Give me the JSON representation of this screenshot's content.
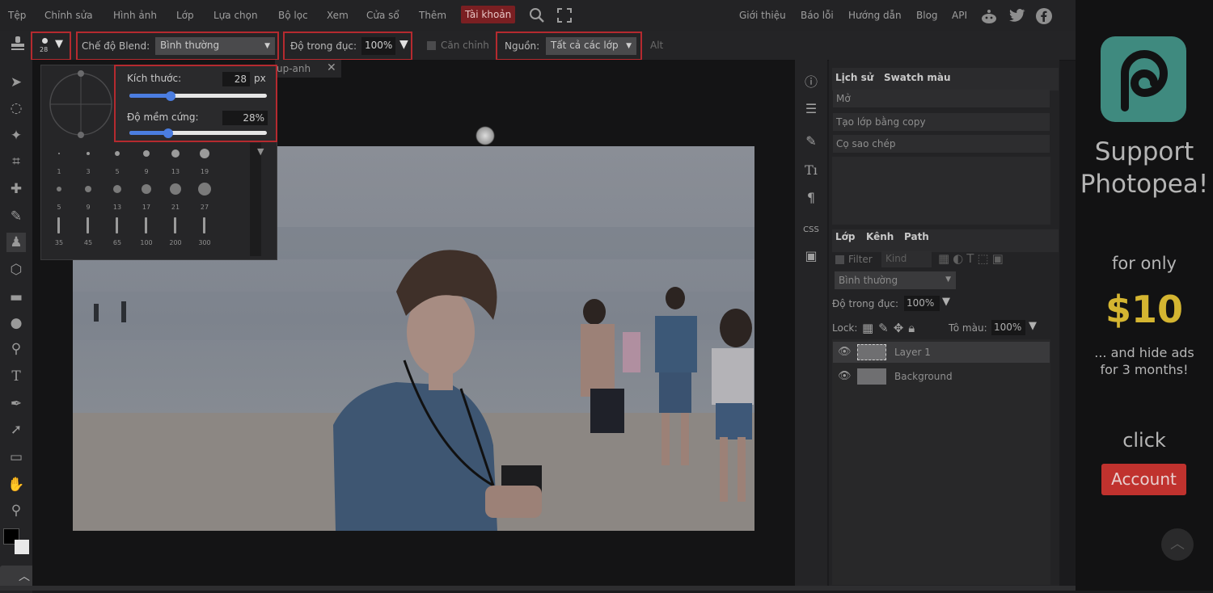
{
  "menu": {
    "items": [
      "Tệp",
      "Chỉnh sửa",
      "Hình ảnh",
      "Lớp",
      "Lựa chọn",
      "Bộ lọc",
      "Xem",
      "Cửa sổ",
      "Thêm",
      "Tài khoản"
    ],
    "right_links": [
      "Giới thiệu",
      "Báo lỗi",
      "Hướng dẫn",
      "Blog",
      "API"
    ]
  },
  "options": {
    "brush_size_small": "28",
    "blend_label": "Chế độ Blend:",
    "blend_value": "Bình thường",
    "opacity_label": "Độ trong đục:",
    "opacity_value": "100%",
    "align_label": "Căn chỉnh",
    "source_label": "Nguồn:",
    "source_value": "Tất cả các lớp",
    "alt_label": "Alt"
  },
  "document_tab": {
    "name": "up-anh"
  },
  "brush_panel": {
    "size_label": "Kích thước:",
    "size_value": "28",
    "size_unit": "px",
    "size_fraction": 0.3,
    "hardness_label": "Độ mềm cứng:",
    "hardness_value": "28%",
    "hardness_fraction": 0.28,
    "presets": [
      "1",
      "3",
      "5",
      "9",
      "13",
      "19",
      "5",
      "9",
      "13",
      "17",
      "21",
      "27",
      "35",
      "45",
      "65",
      "100",
      "200",
      "300"
    ]
  },
  "history_panel": {
    "tabs": [
      "Lịch sử",
      "Swatch màu"
    ],
    "items": [
      "Mở",
      "Tạo lớp bằng copy",
      "Cọ sao chép"
    ]
  },
  "layers_panel": {
    "tabs": [
      "Lớp",
      "Kênh",
      "Path"
    ],
    "filter_label": "Filter",
    "kind_label": "Kind",
    "blend_value": "Bình thường",
    "opacity_label": "Độ trong đục:",
    "opacity_value": "100%",
    "lock_label": "Lock:",
    "fill_label": "Tô màu:",
    "fill_value": "100%",
    "layers": [
      "Layer 1",
      "Background"
    ]
  },
  "ad": {
    "title": "Support Photopea!",
    "for_only": "for only",
    "price": "$10",
    "hide_ads": "... and hide ads for 3 months!",
    "click": "click",
    "button": "Account"
  },
  "colors": {
    "accent_red": "#b52a2f",
    "slider_blue": "#4b7de0",
    "ad_price": "#d4b531",
    "ad_button": "#c0322e",
    "logo_teal": "#3f8a7f"
  }
}
